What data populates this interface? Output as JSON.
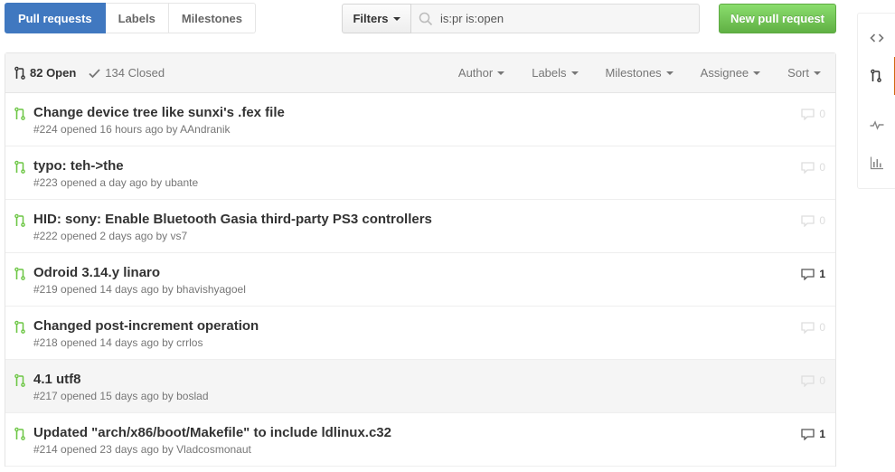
{
  "subnav": {
    "items": [
      {
        "label": "Pull requests",
        "selected": true
      },
      {
        "label": "Labels",
        "selected": false
      },
      {
        "label": "Milestones",
        "selected": false
      }
    ]
  },
  "filters": {
    "button_label": "Filters",
    "search_value": "is:pr is:open"
  },
  "new_pr_label": "New pull request",
  "header": {
    "open_label": "82 Open",
    "closed_label": "134 Closed",
    "filter_menus": [
      "Author",
      "Labels",
      "Milestones",
      "Assignee",
      "Sort"
    ]
  },
  "pull_requests": [
    {
      "title": "Change device tree like sunxi's .fex file",
      "meta": "#224 opened 16 hours ago by AAndranik",
      "comments": "0"
    },
    {
      "title": "typo: teh->the",
      "meta": "#223 opened a day ago by ubante",
      "comments": "0"
    },
    {
      "title": "HID: sony: Enable Bluetooth Gasia third-party PS3 controllers",
      "meta": "#222 opened 2 days ago by vs7",
      "comments": "0"
    },
    {
      "title": "Odroid 3.14.y linaro",
      "meta": "#219 opened 14 days ago by bhavishyagoel",
      "comments": "1"
    },
    {
      "title": "Changed post-increment operation",
      "meta": "#218 opened 14 days ago by crrlos",
      "comments": "0"
    },
    {
      "title": "4.1 utf8",
      "meta": "#217 opened 15 days ago by boslad",
      "comments": "0"
    },
    {
      "title": "Updated \"arch/x86/boot/Makefile\" to include ldlinux.c32",
      "meta": "#214 opened 23 days ago by Vladcosmonaut",
      "comments": "1"
    }
  ],
  "colors": {
    "selected_tab": "#4078c0",
    "new_pr_button": "#6cc644",
    "pr_open_icon": "#6cc644",
    "repo_nav_selected": "#d26911"
  },
  "repo_nav": {
    "items": [
      "code-icon",
      "pull-request-icon",
      "pulse-icon",
      "graph-icon"
    ]
  }
}
